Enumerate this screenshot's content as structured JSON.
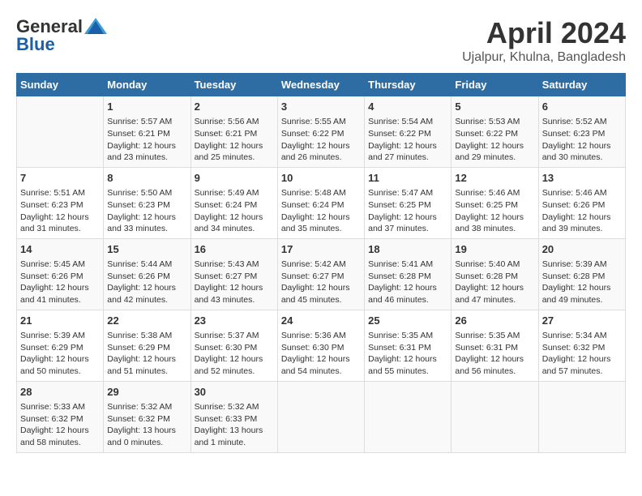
{
  "header": {
    "logo_general": "General",
    "logo_blue": "Blue",
    "title": "April 2024",
    "subtitle": "Ujalpur, Khulna, Bangladesh"
  },
  "days_of_week": [
    "Sunday",
    "Monday",
    "Tuesday",
    "Wednesday",
    "Thursday",
    "Friday",
    "Saturday"
  ],
  "weeks": [
    [
      {
        "num": "",
        "info": ""
      },
      {
        "num": "1",
        "info": "Sunrise: 5:57 AM\nSunset: 6:21 PM\nDaylight: 12 hours\nand 23 minutes."
      },
      {
        "num": "2",
        "info": "Sunrise: 5:56 AM\nSunset: 6:21 PM\nDaylight: 12 hours\nand 25 minutes."
      },
      {
        "num": "3",
        "info": "Sunrise: 5:55 AM\nSunset: 6:22 PM\nDaylight: 12 hours\nand 26 minutes."
      },
      {
        "num": "4",
        "info": "Sunrise: 5:54 AM\nSunset: 6:22 PM\nDaylight: 12 hours\nand 27 minutes."
      },
      {
        "num": "5",
        "info": "Sunrise: 5:53 AM\nSunset: 6:22 PM\nDaylight: 12 hours\nand 29 minutes."
      },
      {
        "num": "6",
        "info": "Sunrise: 5:52 AM\nSunset: 6:23 PM\nDaylight: 12 hours\nand 30 minutes."
      }
    ],
    [
      {
        "num": "7",
        "info": "Sunrise: 5:51 AM\nSunset: 6:23 PM\nDaylight: 12 hours\nand 31 minutes."
      },
      {
        "num": "8",
        "info": "Sunrise: 5:50 AM\nSunset: 6:23 PM\nDaylight: 12 hours\nand 33 minutes."
      },
      {
        "num": "9",
        "info": "Sunrise: 5:49 AM\nSunset: 6:24 PM\nDaylight: 12 hours\nand 34 minutes."
      },
      {
        "num": "10",
        "info": "Sunrise: 5:48 AM\nSunset: 6:24 PM\nDaylight: 12 hours\nand 35 minutes."
      },
      {
        "num": "11",
        "info": "Sunrise: 5:47 AM\nSunset: 6:25 PM\nDaylight: 12 hours\nand 37 minutes."
      },
      {
        "num": "12",
        "info": "Sunrise: 5:46 AM\nSunset: 6:25 PM\nDaylight: 12 hours\nand 38 minutes."
      },
      {
        "num": "13",
        "info": "Sunrise: 5:46 AM\nSunset: 6:26 PM\nDaylight: 12 hours\nand 39 minutes."
      }
    ],
    [
      {
        "num": "14",
        "info": "Sunrise: 5:45 AM\nSunset: 6:26 PM\nDaylight: 12 hours\nand 41 minutes."
      },
      {
        "num": "15",
        "info": "Sunrise: 5:44 AM\nSunset: 6:26 PM\nDaylight: 12 hours\nand 42 minutes."
      },
      {
        "num": "16",
        "info": "Sunrise: 5:43 AM\nSunset: 6:27 PM\nDaylight: 12 hours\nand 43 minutes."
      },
      {
        "num": "17",
        "info": "Sunrise: 5:42 AM\nSunset: 6:27 PM\nDaylight: 12 hours\nand 45 minutes."
      },
      {
        "num": "18",
        "info": "Sunrise: 5:41 AM\nSunset: 6:28 PM\nDaylight: 12 hours\nand 46 minutes."
      },
      {
        "num": "19",
        "info": "Sunrise: 5:40 AM\nSunset: 6:28 PM\nDaylight: 12 hours\nand 47 minutes."
      },
      {
        "num": "20",
        "info": "Sunrise: 5:39 AM\nSunset: 6:28 PM\nDaylight: 12 hours\nand 49 minutes."
      }
    ],
    [
      {
        "num": "21",
        "info": "Sunrise: 5:39 AM\nSunset: 6:29 PM\nDaylight: 12 hours\nand 50 minutes."
      },
      {
        "num": "22",
        "info": "Sunrise: 5:38 AM\nSunset: 6:29 PM\nDaylight: 12 hours\nand 51 minutes."
      },
      {
        "num": "23",
        "info": "Sunrise: 5:37 AM\nSunset: 6:30 PM\nDaylight: 12 hours\nand 52 minutes."
      },
      {
        "num": "24",
        "info": "Sunrise: 5:36 AM\nSunset: 6:30 PM\nDaylight: 12 hours\nand 54 minutes."
      },
      {
        "num": "25",
        "info": "Sunrise: 5:35 AM\nSunset: 6:31 PM\nDaylight: 12 hours\nand 55 minutes."
      },
      {
        "num": "26",
        "info": "Sunrise: 5:35 AM\nSunset: 6:31 PM\nDaylight: 12 hours\nand 56 minutes."
      },
      {
        "num": "27",
        "info": "Sunrise: 5:34 AM\nSunset: 6:32 PM\nDaylight: 12 hours\nand 57 minutes."
      }
    ],
    [
      {
        "num": "28",
        "info": "Sunrise: 5:33 AM\nSunset: 6:32 PM\nDaylight: 12 hours\nand 58 minutes."
      },
      {
        "num": "29",
        "info": "Sunrise: 5:32 AM\nSunset: 6:32 PM\nDaylight: 13 hours\nand 0 minutes."
      },
      {
        "num": "30",
        "info": "Sunrise: 5:32 AM\nSunset: 6:33 PM\nDaylight: 13 hours\nand 1 minute."
      },
      {
        "num": "",
        "info": ""
      },
      {
        "num": "",
        "info": ""
      },
      {
        "num": "",
        "info": ""
      },
      {
        "num": "",
        "info": ""
      }
    ]
  ]
}
